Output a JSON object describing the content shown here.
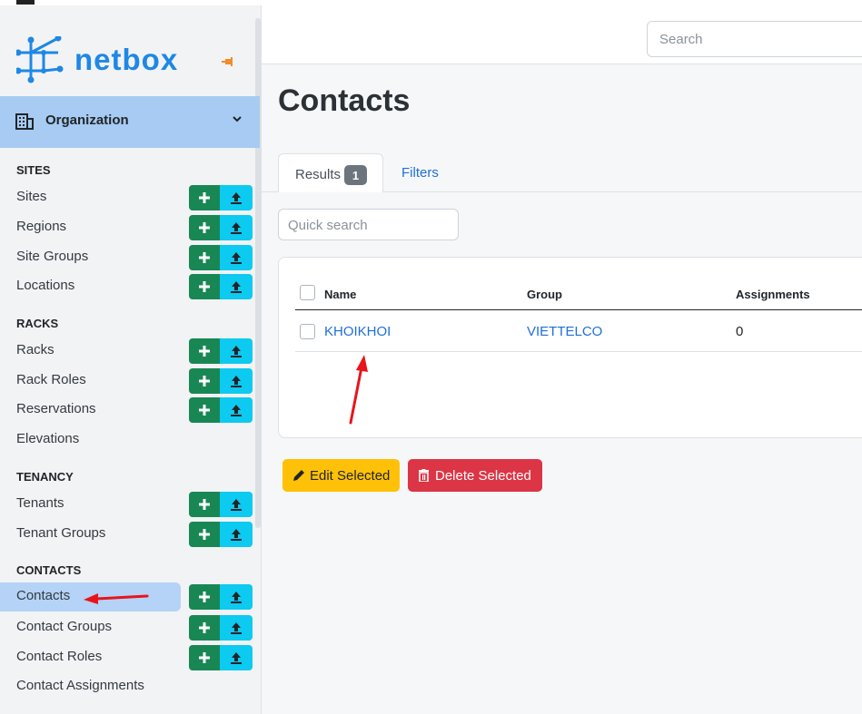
{
  "brand": {
    "name": "netbox",
    "accent": "#1e88e5"
  },
  "header": {
    "search_placeholder": "Search"
  },
  "sidebar": {
    "menu_group": "Organization",
    "sections": [
      {
        "title": "SITES",
        "items": [
          {
            "label": "Sites",
            "buttons": true
          },
          {
            "label": "Regions",
            "buttons": true
          },
          {
            "label": "Site Groups",
            "buttons": true
          },
          {
            "label": "Locations",
            "buttons": true
          }
        ]
      },
      {
        "title": "RACKS",
        "items": [
          {
            "label": "Racks",
            "buttons": true
          },
          {
            "label": "Rack Roles",
            "buttons": true
          },
          {
            "label": "Reservations",
            "buttons": true
          },
          {
            "label": "Elevations",
            "buttons": false
          }
        ]
      },
      {
        "title": "TENANCY",
        "items": [
          {
            "label": "Tenants",
            "buttons": true
          },
          {
            "label": "Tenant Groups",
            "buttons": true
          }
        ]
      },
      {
        "title": "CONTACTS",
        "items": [
          {
            "label": "Contacts",
            "buttons": true,
            "active": true
          },
          {
            "label": "Contact Groups",
            "buttons": true
          },
          {
            "label": "Contact Roles",
            "buttons": true
          },
          {
            "label": "Contact Assignments",
            "buttons": false
          }
        ]
      }
    ]
  },
  "page": {
    "title": "Contacts",
    "tabs": {
      "results_label": "Results",
      "results_count": "1",
      "filters_label": "Filters"
    },
    "quick_search_placeholder": "Quick search",
    "table": {
      "columns": [
        "Name",
        "Group",
        "Assignments"
      ],
      "rows": [
        {
          "name": "KHOIKHOI",
          "group": "VIETTELCO",
          "assignments": "0"
        }
      ]
    },
    "buttons": {
      "edit_label": "Edit Selected",
      "delete_label": "Delete Selected"
    }
  },
  "colors": {
    "add_button": "#198754",
    "import_button": "#0dcaf0",
    "edit_button": "#ffc107",
    "delete_button": "#dc3545",
    "annotation_arrow": "#e8141b"
  }
}
